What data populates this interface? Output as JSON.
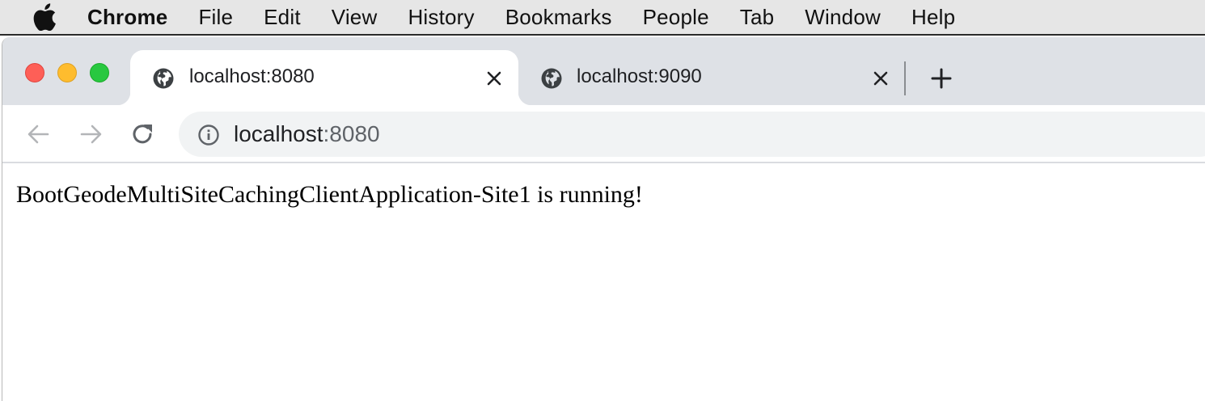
{
  "menubar": {
    "items": [
      "Chrome",
      "File",
      "Edit",
      "View",
      "History",
      "Bookmarks",
      "People",
      "Tab",
      "Window",
      "Help"
    ]
  },
  "tabs": [
    {
      "title": "localhost:8080",
      "active": true
    },
    {
      "title": "localhost:9090",
      "active": false
    }
  ],
  "omnibox": {
    "host": "localhost",
    "port": ":8080"
  },
  "page": {
    "message": "BootGeodeMultiSiteCachingClientApplication-Site1 is running!"
  },
  "colors": {
    "tabstrip": "#dee1e6",
    "close": "#fe5f57",
    "minimize": "#febc2e",
    "maximize": "#28c840"
  },
  "icons": {
    "apple": "apple-logo-icon",
    "favicon": "globe-icon",
    "close_tab": "close-icon",
    "new_tab": "plus-icon",
    "back": "arrow-left-icon",
    "forward": "arrow-right-icon",
    "reload": "reload-icon",
    "site_info": "info-icon"
  }
}
